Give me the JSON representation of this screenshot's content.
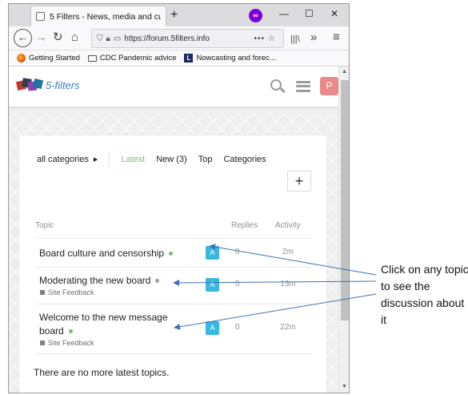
{
  "browser": {
    "tab_title": "5 Filters - News, media and cu",
    "tab_close": "✕",
    "new_tab": "+",
    "private_badge": "∞",
    "window": {
      "minimize": "—",
      "maximize": "☐",
      "close": "✕"
    },
    "nav": {
      "back": "←",
      "forward": "→",
      "reload": "↻",
      "home": "⌂"
    },
    "url": "https://forum.5filters.info",
    "url_menu": "•••",
    "library": "|||\\",
    "overflow": "»",
    "menu": "≡",
    "bookmarks": [
      {
        "label": "Getting Started",
        "icon": "firefox-icon"
      },
      {
        "label": "CDC Pandemic advice",
        "icon": "folder-icon"
      },
      {
        "label": "Nowcasting and forec...",
        "icon": "l-logo-icon",
        "icon_text": "L"
      }
    ]
  },
  "site": {
    "logo_text": "5-filters",
    "avatar_letter": "P",
    "colors": {
      "accent_green": "#82b97e",
      "avatar": "#e88a8a",
      "poster": "#38b8df",
      "logo_blue": "#3b7fc4"
    }
  },
  "filters": {
    "all_categories": "all categories",
    "tabs": [
      "Latest",
      "New (3)",
      "Top",
      "Categories"
    ],
    "active_tab": "Latest",
    "create_button": "+"
  },
  "table": {
    "headers": {
      "topic": "Topic",
      "replies": "Replies",
      "activity": "Activity"
    },
    "rows": [
      {
        "title": "Board culture and censorship",
        "category": "",
        "poster": "A",
        "replies": "0",
        "activity": "2m"
      },
      {
        "title": "Moderating the new board",
        "category": "Site Feedback",
        "poster": "A",
        "replies": "0",
        "activity": "13m"
      },
      {
        "title": "Welcome to the new message board",
        "category": "Site Feedback",
        "poster": "A",
        "replies": "0",
        "activity": "22m"
      }
    ],
    "footer": "There are no more latest topics."
  },
  "annotation": {
    "text": "Click on any topic to see the discussion about it"
  }
}
